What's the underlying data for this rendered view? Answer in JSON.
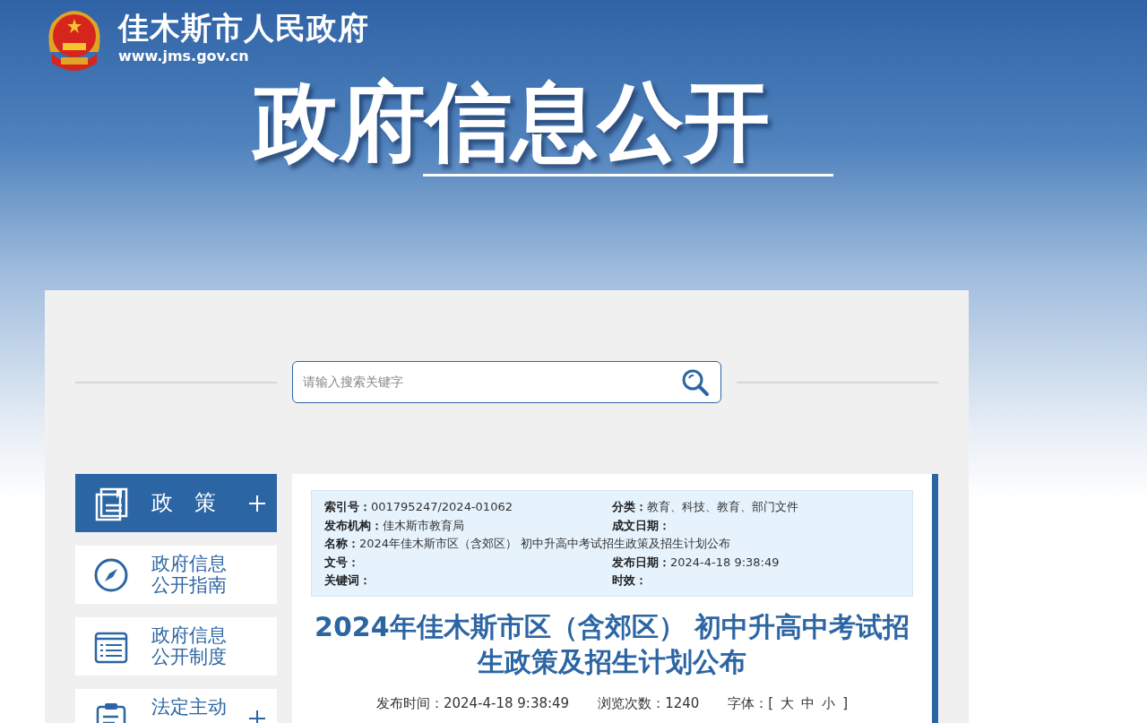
{
  "site": {
    "name": "佳木斯市人民政府",
    "url": "www.jms.gov.cn"
  },
  "banner": {
    "title": "政府信息公开"
  },
  "search": {
    "placeholder": "请输入搜索关键字"
  },
  "sidebar": {
    "items": [
      {
        "label": "政　策",
        "kind": "book",
        "selected": true,
        "expandable": true
      },
      {
        "label": "政府信息公开指南",
        "kind": "compass",
        "selected": false,
        "expandable": false
      },
      {
        "label": "政府信息公开制度",
        "kind": "list",
        "selected": false,
        "expandable": false
      },
      {
        "label": "法定主动",
        "kind": "clipboard",
        "selected": false,
        "expandable": true
      }
    ]
  },
  "meta": {
    "rows": [
      [
        {
          "label": "索引号：",
          "value": "001795247/2024-01062"
        },
        {
          "label": "分类：",
          "value": "教育、科技、教育、部门文件"
        }
      ],
      [
        {
          "label": "发布机构：",
          "value": "佳木斯市教育局"
        },
        {
          "label": "成文日期："
        }
      ],
      [
        {
          "label": "名称：",
          "value": "2024年佳木斯市区（含郊区） 初中升高中考试招生政策及招生计划公布"
        }
      ],
      [
        {
          "label": "文号："
        },
        {
          "label": "发布日期：",
          "value": "2024-4-18 9:38:49"
        }
      ],
      [
        {
          "label": "关键词："
        },
        {
          "label": "时效："
        }
      ]
    ]
  },
  "article": {
    "title": "2024年佳木斯市区（含郊区） 初中升高中考试招生政策及招生计划公布",
    "publish_time": "发布时间：2024-4-18 9:38:49",
    "views": "浏览次数：1240",
    "font_label": "字体：[",
    "font_sizes": [
      "大",
      "中",
      "小"
    ],
    "font_close": "]"
  }
}
